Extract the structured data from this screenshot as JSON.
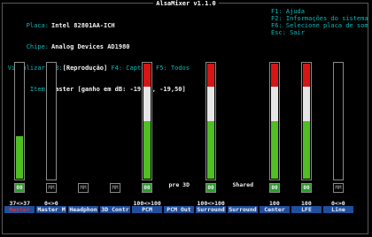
{
  "title": "AlsaMixer v1.1.0",
  "info": {
    "card_label": "Placa:",
    "card_value": "Intel 82801AA-ICH",
    "chip_label": "Chipe:",
    "chip_value": "Analog Devices AD1980",
    "view_label": "Visualizar:",
    "view_f3": "F3:",
    "view_playback": "[Reprodução]",
    "view_f4": "F4: Captura",
    "view_f5": "F5: Todos",
    "item_label": "Item:",
    "item_value": "Master [ganho em dB: -19,50, -19,50]"
  },
  "help": [
    "F1: Ajuda",
    "F2: Informações do sistema",
    "F6: Selecione placa de som",
    "Esc: Sair"
  ],
  "controls": [
    {
      "name": "Master",
      "value": "37<>37",
      "mute": "00",
      "level": 0.37,
      "selected": true
    },
    {
      "name": "Master M",
      "value": "0<>0",
      "mute": "MM",
      "level": 0
    },
    {
      "name": "Headphon",
      "value": "",
      "mute": "MM",
      "level": null
    },
    {
      "name": "3D Contr",
      "value": "",
      "mute": "MM",
      "level": null
    },
    {
      "name": "PCM",
      "value": "100<>100",
      "mute": "00",
      "level": 1
    },
    {
      "name": "PCM Out",
      "value": "",
      "mute": "",
      "level": null,
      "extra": "pre 3D"
    },
    {
      "name": "Surround",
      "value": "100<>100",
      "mute": "00",
      "level": 1
    },
    {
      "name": "Surround",
      "value": "",
      "mute": "",
      "level": null,
      "extra": "Shared"
    },
    {
      "name": "Center",
      "value": "100",
      "mute": "00",
      "level": 1
    },
    {
      "name": "LFE",
      "value": "100",
      "mute": "00",
      "level": 1
    },
    {
      "name": "Line",
      "value": "0<>0",
      "mute": "MM",
      "level": 0
    }
  ],
  "colors": {
    "green": "#4fbf22",
    "white": "#e6e6e6",
    "red": "#d91414",
    "label_bg": "#1f4f9e"
  }
}
